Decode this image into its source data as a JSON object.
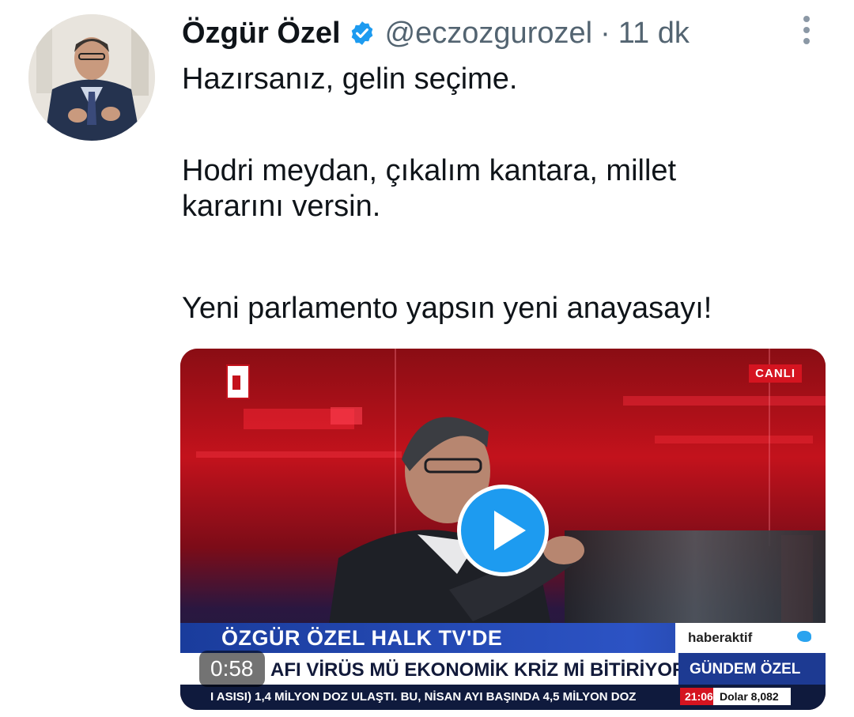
{
  "tweet": {
    "author_name": "Özgür Özel",
    "handle": "@eczozgurozel",
    "separator": "·",
    "time": "11 dk",
    "lines": [
      "Hazırsanız, gelin seçime.",
      "Hodri meydan, çıkalım kantara, millet",
      "kararını versin.",
      "Yeni parlamento yapsın yeni anayasayı!"
    ]
  },
  "video": {
    "live_label": "CANLI",
    "headline": "ÖZGÜR ÖZEL HALK TV'DE",
    "channel_tag": "haberaktif",
    "subheadline": "AFI VİRÜS MÜ EKONOMİK KRİZ Mİ BİTİRİYOR?",
    "program_tag": "GÜNDEM ÖZEL",
    "ticker": "I ASISI) 1,4 MİLYON DOZ ULAŞTI. BU, NİSAN AYI BAŞINDA 4,5 MİLYON DOZ",
    "clock": "21:06",
    "currency": "Dolar 8,082",
    "duration": "0:58"
  },
  "colors": {
    "verified": "#1d9bf0",
    "play": "#1d9bf0",
    "secondary_text": "#536471"
  },
  "icons": [
    "verified-badge-icon",
    "more-icon",
    "play-icon",
    "twitter-bird-icon"
  ]
}
